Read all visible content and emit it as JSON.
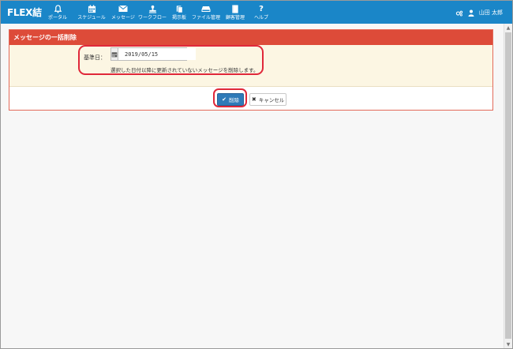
{
  "app": {
    "brand": "FLEX結"
  },
  "nav": {
    "items": [
      {
        "label": "ポータル",
        "icon": "bell-icon"
      },
      {
        "label": "スケジュール",
        "icon": "calendar-icon"
      },
      {
        "label": "メッセージ",
        "icon": "envelope-icon"
      },
      {
        "label": "ワークフロー",
        "icon": "stamp-icon"
      },
      {
        "label": "掲示板",
        "icon": "clipboard-icon"
      },
      {
        "label": "ファイル管理",
        "icon": "drive-icon"
      },
      {
        "label": "顧客管理",
        "icon": "book-icon"
      },
      {
        "label": "ヘルプ",
        "icon": "question-icon"
      }
    ],
    "user_name": "山田 太郎"
  },
  "panel": {
    "title": "メッセージの一括削除",
    "date_label": "基準日：",
    "date_value": "2019/05/15",
    "help_text": "選択した日付以降に更新されていないメッセージを削除します。",
    "delete_label": "削除",
    "cancel_label": "キャンセル"
  },
  "colors": {
    "navbar": "#1a86c8",
    "panel_heading": "#dd4b39",
    "panel_body": "#fcf6e3",
    "primary_button": "#2f7ab8",
    "highlight": "#e0283a"
  }
}
